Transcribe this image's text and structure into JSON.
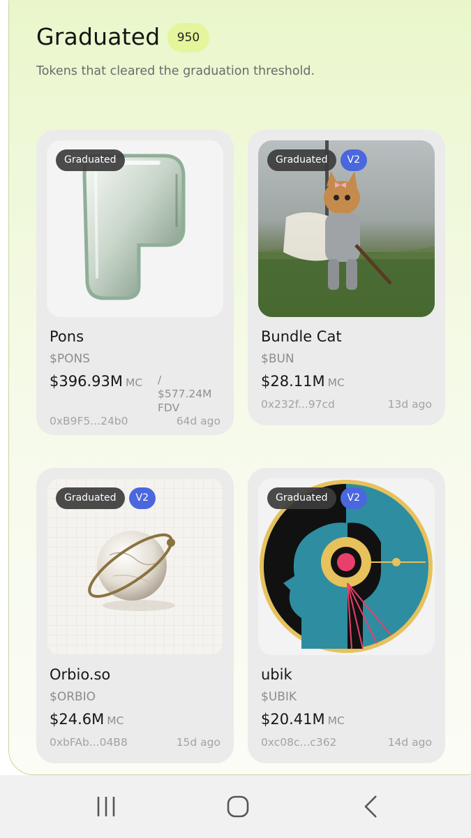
{
  "header": {
    "title": "Graduated",
    "count": "950",
    "subtitle": "Tokens that cleared the graduation threshold."
  },
  "cards": [
    {
      "name": "Pons",
      "ticker": "$PONS",
      "price": "$396.93M",
      "mc": "MC",
      "fdv_line1": "/",
      "fdv_line2": "$577.24M",
      "fdv_line3": "FDV",
      "address": "0xB9F5...24b0",
      "age": "64d ago",
      "badges": [
        "Graduated"
      ],
      "image": "glass-p-logo"
    },
    {
      "name": "Bundle Cat",
      "ticker": "$BUN",
      "price": "$28.11M",
      "mc": "MC",
      "address": "0x232f...97cd",
      "age": "13d ago",
      "badges": [
        "Graduated",
        "V2"
      ],
      "image": "knight-kitten-photo"
    },
    {
      "name": "Orbio.so",
      "ticker": "$ORBIO",
      "price": "$24.6M",
      "mc": "MC",
      "address": "0xbFAb...04B8",
      "age": "15d ago",
      "badges": [
        "Graduated",
        "V2"
      ],
      "image": "marble-planet-ring"
    },
    {
      "name": "ubik",
      "ticker": "$UBIK",
      "price": "$20.41M",
      "mc": "MC",
      "address": "0xc08c...c362",
      "age": "14d ago",
      "badges": [
        "Graduated",
        "V2"
      ],
      "image": "profile-head-circle-art"
    }
  ],
  "nav": {
    "icons": [
      "recent-apps-icon",
      "home-icon",
      "back-icon"
    ]
  },
  "colors": {
    "accent_badge": "#e5f59c",
    "v2_badge": "#4a67dd",
    "graduated_badge": "#3c3c3c",
    "card_bg": "#ebebeb"
  }
}
